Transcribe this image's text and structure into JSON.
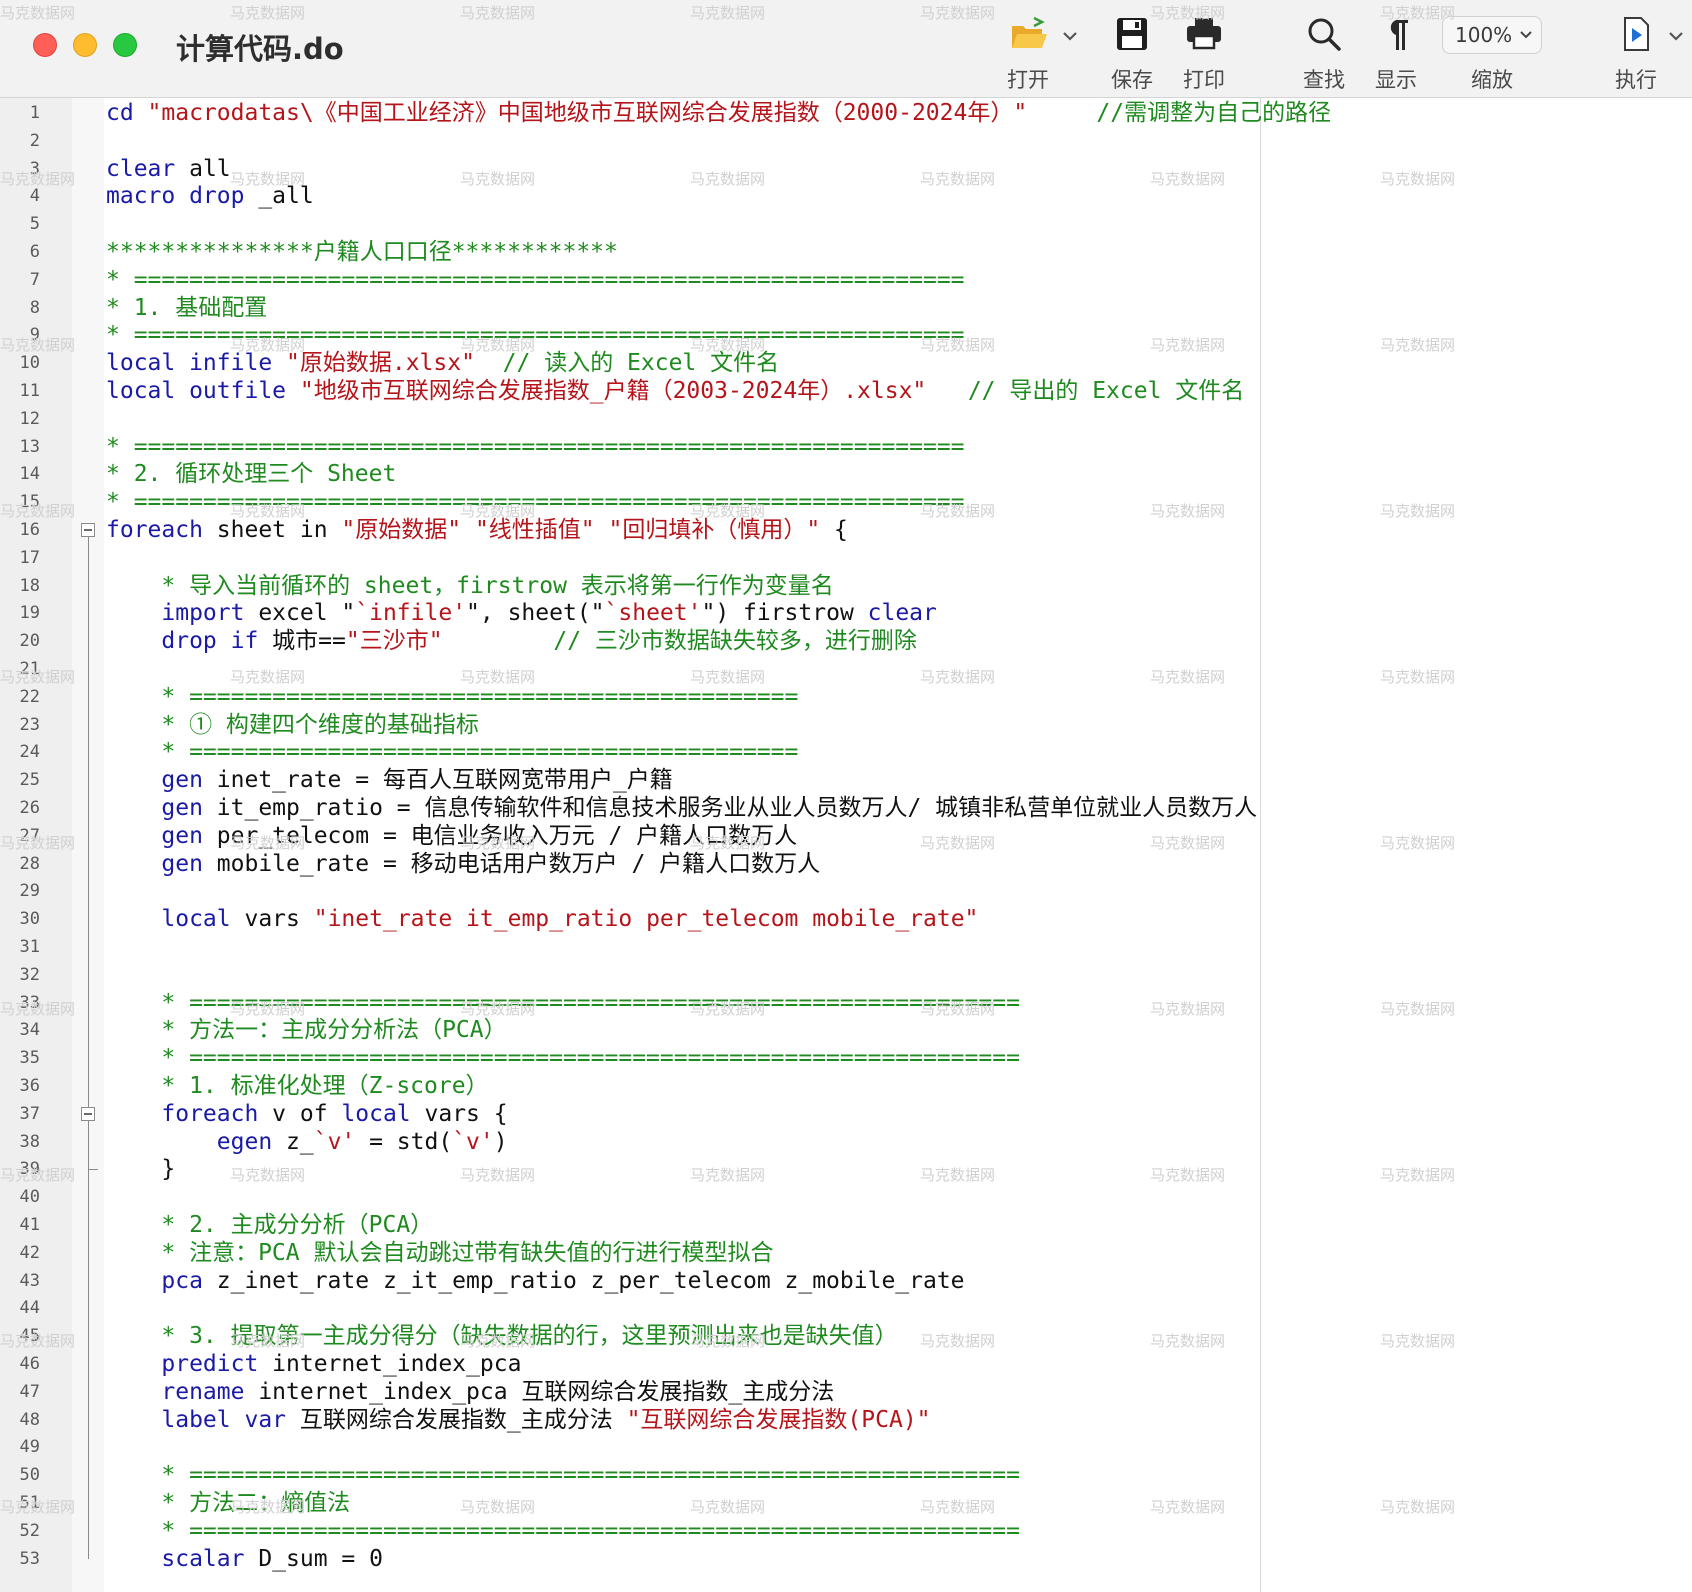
{
  "window": {
    "title": "计算代码.do",
    "traffic_lights": {
      "close": "#ff5f57",
      "minimize": "#febc2e",
      "maximize": "#28c840"
    }
  },
  "toolbar": {
    "open": "打开",
    "save": "保存",
    "print": "打印",
    "find": "查找",
    "show": "显示",
    "zoom_label": "缩放",
    "zoom_value": "100%",
    "execute": "执行",
    "icons": [
      "folder-open-icon",
      "chevron-down-icon",
      "floppy-save-icon",
      "printer-icon",
      "magnifier-icon",
      "pilcrow-icon",
      "chevron-down-icon",
      "run-document-icon",
      "chevron-down-icon"
    ]
  },
  "colors": {
    "keyword": "#1a1aa6",
    "string": "#b5151a",
    "comment": "#1f8a1f",
    "text": "#111111",
    "line_number": "#5a5a5a"
  },
  "watermark": "马克数据网",
  "editor": {
    "lines": [
      {
        "n": "1",
        "tokens": [
          {
            "t": "cd ",
            "c": "kw"
          },
          {
            "t": "\"macrodatas\\《中国工业经济》中国地级市互联网综合发展指数（2000-2024年）\"",
            "c": "str"
          },
          {
            "t": "     //需调整为自己的路径",
            "c": "cmt"
          }
        ]
      },
      {
        "n": "2",
        "tokens": []
      },
      {
        "n": "3",
        "tokens": [
          {
            "t": "clear ",
            "c": "kw"
          },
          {
            "t": "all",
            "c": "txt"
          }
        ]
      },
      {
        "n": "4",
        "tokens": [
          {
            "t": "macro drop ",
            "c": "kw"
          },
          {
            "t": "_all",
            "c": "txt"
          }
        ]
      },
      {
        "n": "5",
        "tokens": []
      },
      {
        "n": "6",
        "tokens": [
          {
            "t": "***************户籍人口口径************",
            "c": "cmt"
          }
        ]
      },
      {
        "n": "7",
        "tokens": [
          {
            "t": "* ============================================================",
            "c": "cmt"
          }
        ]
      },
      {
        "n": "8",
        "tokens": [
          {
            "t": "* 1. 基础配置",
            "c": "cmt"
          }
        ]
      },
      {
        "n": "9",
        "tokens": [
          {
            "t": "* ============================================================",
            "c": "cmt"
          }
        ]
      },
      {
        "n": "10",
        "tokens": [
          {
            "t": "local infile ",
            "c": "kw"
          },
          {
            "t": "\"原始数据.xlsx\"",
            "c": "str"
          },
          {
            "t": "  // 读入的 Excel 文件名",
            "c": "cmt"
          }
        ]
      },
      {
        "n": "11",
        "tokens": [
          {
            "t": "local outfile ",
            "c": "kw"
          },
          {
            "t": "\"地级市互联网综合发展指数_户籍（2003-2024年）.xlsx\"",
            "c": "str"
          },
          {
            "t": "   // 导出的 Excel 文件名",
            "c": "cmt"
          }
        ]
      },
      {
        "n": "12",
        "tokens": []
      },
      {
        "n": "13",
        "tokens": [
          {
            "t": "* ============================================================",
            "c": "cmt"
          }
        ]
      },
      {
        "n": "14",
        "tokens": [
          {
            "t": "* 2. 循环处理三个 Sheet",
            "c": "cmt"
          }
        ]
      },
      {
        "n": "15",
        "tokens": [
          {
            "t": "* ============================================================",
            "c": "cmt"
          }
        ]
      },
      {
        "n": "16",
        "tokens": [
          {
            "t": "foreach ",
            "c": "kw"
          },
          {
            "t": "sheet in ",
            "c": "txt"
          },
          {
            "t": "\"原始数据\" \"线性插值\" \"回归填补（慎用）\"",
            "c": "str"
          },
          {
            "t": " {",
            "c": "txt"
          }
        ]
      },
      {
        "n": "17",
        "tokens": []
      },
      {
        "n": "18",
        "tokens": [
          {
            "t": "    * 导入当前循环的 sheet，firstrow 表示将第一行作为变量名",
            "c": "cmt"
          }
        ]
      },
      {
        "n": "19",
        "tokens": [
          {
            "t": "    import ",
            "c": "kw"
          },
          {
            "t": "excel \"",
            "c": "txt"
          },
          {
            "t": "`infile'",
            "c": "str"
          },
          {
            "t": "\", sheet(\"",
            "c": "txt"
          },
          {
            "t": "`sheet'",
            "c": "str"
          },
          {
            "t": "\") firstrow ",
            "c": "txt"
          },
          {
            "t": "clear",
            "c": "kw"
          }
        ]
      },
      {
        "n": "20",
        "tokens": [
          {
            "t": "    drop if ",
            "c": "kw"
          },
          {
            "t": "城市==",
            "c": "txt"
          },
          {
            "t": "\"三沙市\"",
            "c": "str"
          },
          {
            "t": "        // 三沙市数据缺失较多，进行删除",
            "c": "cmt"
          }
        ]
      },
      {
        "n": "21",
        "tokens": []
      },
      {
        "n": "22",
        "tokens": [
          {
            "t": "    * ============================================",
            "c": "cmt"
          }
        ]
      },
      {
        "n": "23",
        "tokens": [
          {
            "t": "    * ① 构建四个维度的基础指标",
            "c": "cmt"
          }
        ]
      },
      {
        "n": "24",
        "tokens": [
          {
            "t": "    * ============================================",
            "c": "cmt"
          }
        ]
      },
      {
        "n": "25",
        "tokens": [
          {
            "t": "    gen ",
            "c": "kw"
          },
          {
            "t": "inet_rate = 每百人互联网宽带用户_户籍",
            "c": "txt"
          }
        ]
      },
      {
        "n": "26",
        "tokens": [
          {
            "t": "    gen ",
            "c": "kw"
          },
          {
            "t": "it_emp_ratio = 信息传输软件和信息技术服务业从业人员数万人/ 城镇非私营单位就业人员数万人",
            "c": "txt"
          }
        ]
      },
      {
        "n": "27",
        "tokens": [
          {
            "t": "    gen ",
            "c": "kw"
          },
          {
            "t": "per_telecom = 电信业务收入万元 / 户籍人口数万人",
            "c": "txt"
          }
        ]
      },
      {
        "n": "28",
        "tokens": [
          {
            "t": "    gen ",
            "c": "kw"
          },
          {
            "t": "mobile_rate = 移动电话用户数万户 / 户籍人口数万人",
            "c": "txt"
          }
        ]
      },
      {
        "n": "29",
        "tokens": []
      },
      {
        "n": "30",
        "tokens": [
          {
            "t": "    local ",
            "c": "kw"
          },
          {
            "t": "vars ",
            "c": "txt"
          },
          {
            "t": "\"inet_rate it_emp_ratio per_telecom mobile_rate\"",
            "c": "str"
          }
        ]
      },
      {
        "n": "31",
        "tokens": []
      },
      {
        "n": "32",
        "tokens": []
      },
      {
        "n": "33",
        "tokens": [
          {
            "t": "    * ============================================================",
            "c": "cmt"
          }
        ]
      },
      {
        "n": "34",
        "tokens": [
          {
            "t": "    * 方法一：主成分分析法（PCA）",
            "c": "cmt"
          }
        ]
      },
      {
        "n": "35",
        "tokens": [
          {
            "t": "    * ============================================================",
            "c": "cmt"
          }
        ]
      },
      {
        "n": "36",
        "tokens": [
          {
            "t": "    * 1. 标准化处理（Z-score）",
            "c": "cmt"
          }
        ]
      },
      {
        "n": "37",
        "tokens": [
          {
            "t": "    foreach ",
            "c": "kw"
          },
          {
            "t": "v of ",
            "c": "txt"
          },
          {
            "t": "local ",
            "c": "kw"
          },
          {
            "t": "vars {",
            "c": "txt"
          }
        ]
      },
      {
        "n": "38",
        "tokens": [
          {
            "t": "        egen ",
            "c": "kw"
          },
          {
            "t": "z_",
            "c": "txt"
          },
          {
            "t": "`v'",
            "c": "str"
          },
          {
            "t": " = std(",
            "c": "txt"
          },
          {
            "t": "`v'",
            "c": "str"
          },
          {
            "t": ")",
            "c": "txt"
          }
        ]
      },
      {
        "n": "39",
        "tokens": [
          {
            "t": "    }",
            "c": "txt"
          }
        ]
      },
      {
        "n": "40",
        "tokens": []
      },
      {
        "n": "41",
        "tokens": [
          {
            "t": "    * 2. 主成分分析（PCA）",
            "c": "cmt"
          }
        ]
      },
      {
        "n": "42",
        "tokens": [
          {
            "t": "    * 注意：PCA 默认会自动跳过带有缺失值的行进行模型拟合",
            "c": "cmt"
          }
        ]
      },
      {
        "n": "43",
        "tokens": [
          {
            "t": "    pca ",
            "c": "kw"
          },
          {
            "t": "z_inet_rate z_it_emp_ratio z_per_telecom z_mobile_rate",
            "c": "txt"
          }
        ]
      },
      {
        "n": "44",
        "tokens": []
      },
      {
        "n": "45",
        "tokens": [
          {
            "t": "    * 3. 提取第一主成分得分（缺失数据的行，这里预测出来也是缺失值）",
            "c": "cmt"
          }
        ]
      },
      {
        "n": "46",
        "tokens": [
          {
            "t": "    predict ",
            "c": "kw"
          },
          {
            "t": "internet_index_pca",
            "c": "txt"
          }
        ]
      },
      {
        "n": "47",
        "tokens": [
          {
            "t": "    rename ",
            "c": "kw"
          },
          {
            "t": "internet_index_pca 互联网综合发展指数_主成分法",
            "c": "txt"
          }
        ]
      },
      {
        "n": "48",
        "tokens": [
          {
            "t": "    label var ",
            "c": "kw"
          },
          {
            "t": "互联网综合发展指数_主成分法 ",
            "c": "txt"
          },
          {
            "t": "\"互联网综合发展指数(PCA)\"",
            "c": "str"
          }
        ]
      },
      {
        "n": "49",
        "tokens": []
      },
      {
        "n": "50",
        "tokens": [
          {
            "t": "    * ============================================================",
            "c": "cmt"
          }
        ]
      },
      {
        "n": "51",
        "tokens": [
          {
            "t": "    * 方法二：熵值法",
            "c": "cmt"
          }
        ]
      },
      {
        "n": "52",
        "tokens": [
          {
            "t": "    * ============================================================",
            "c": "cmt"
          }
        ]
      },
      {
        "n": "53",
        "tokens": [
          {
            "t": "    scalar ",
            "c": "kw"
          },
          {
            "t": "D_sum = 0",
            "c": "txt"
          }
        ]
      }
    ],
    "folds": [
      {
        "start": "16",
        "end": "53"
      },
      {
        "start": "37",
        "end": "39"
      }
    ]
  }
}
